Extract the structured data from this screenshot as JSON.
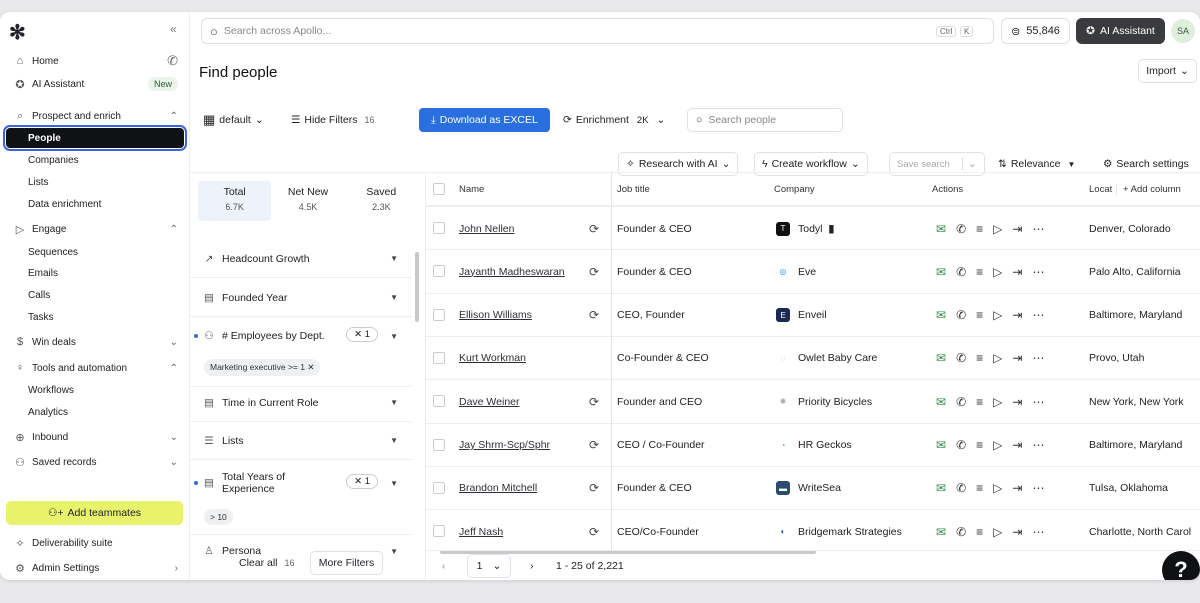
{
  "sidebar": {
    "items": [
      {
        "label": "Home"
      },
      {
        "label": "AI Assistant",
        "badge": "New"
      },
      {
        "label": "Prospect and enrich"
      },
      {
        "label": "People"
      },
      {
        "label": "Companies"
      },
      {
        "label": "Lists"
      },
      {
        "label": "Data enrichment"
      },
      {
        "label": "Engage"
      },
      {
        "label": "Sequences"
      },
      {
        "label": "Emails"
      },
      {
        "label": "Calls"
      },
      {
        "label": "Tasks"
      },
      {
        "label": "Win deals"
      },
      {
        "label": "Tools and automation"
      },
      {
        "label": "Workflows"
      },
      {
        "label": "Analytics"
      },
      {
        "label": "Inbound"
      },
      {
        "label": "Saved records"
      }
    ],
    "add_teammates": "Add teammates",
    "deliverability": "Deliverability suite",
    "admin": "Admin Settings"
  },
  "topbar": {
    "search_placeholder": "Search across Apollo...",
    "kbd_ctrl": "Ctrl",
    "kbd_k": "K",
    "credits": "55,846",
    "ai_button": "AI Assistant",
    "avatar": "SA"
  },
  "page": {
    "title": "Find people",
    "import": "Import"
  },
  "toolbar": {
    "view": "default",
    "hide_filters": "Hide Filters",
    "hide_filters_count": "16",
    "download": "Download as EXCEL",
    "enrichment": "Enrichment",
    "enrichment_count": "2K",
    "search_people": "Search people",
    "research_ai": "Research with AI",
    "create_workflow": "Create workflow",
    "save_search": "Save search",
    "relevance": "Relevance",
    "search_settings": "Search settings"
  },
  "counts": [
    {
      "label": "Total",
      "value": "6.7K"
    },
    {
      "label": "Net New",
      "value": "4.5K"
    },
    {
      "label": "Saved",
      "value": "2.3K"
    }
  ],
  "filters": {
    "headcount": "Headcount Growth",
    "founded": "Founded Year",
    "employees": "# Employees by Dept.",
    "employees_count": "1",
    "employees_chip": "Marketing executive >= 1",
    "time_role": "Time in Current Role",
    "lists": "Lists",
    "total_years": "Total Years of Experience",
    "total_years_count": "1",
    "total_years_chip": "> 10",
    "persona": "Persona",
    "clear_all": "Clear all",
    "clear_count": "16",
    "more_filters": "More Filters"
  },
  "table": {
    "headers": {
      "name": "Name",
      "job": "Job title",
      "company": "Company",
      "actions": "Actions",
      "location": "Locat",
      "add_column": "+ Add column"
    },
    "rows": [
      {
        "name": "John Nellen",
        "job": "Founder & CEO",
        "company": "Todyl",
        "location": "Denver, Colorado"
      },
      {
        "name": "Jayanth Madheswaran",
        "job": "Founder & CEO",
        "company": "Eve",
        "location": "Palo Alto, California"
      },
      {
        "name": "Ellison Williams",
        "job": "CEO, Founder",
        "company": "Enveil",
        "location": "Baltimore, Maryland"
      },
      {
        "name": "Kurt Workman",
        "job": "Co-Founder & CEO",
        "company": "Owlet Baby Care",
        "location": "Provo, Utah"
      },
      {
        "name": "Dave Weiner",
        "job": "Founder and CEO",
        "company": "Priority Bicycles",
        "location": "New York, New York"
      },
      {
        "name": "Jay Shrm-Scp/Sphr",
        "job": "CEO / Co-Founder",
        "company": "HR Geckos",
        "location": "Baltimore, Maryland"
      },
      {
        "name": "Brandon Mitchell",
        "job": "Founder & CEO",
        "company": "WriteSea",
        "location": "Tulsa, Oklahoma"
      },
      {
        "name": "Jeff Nash",
        "job": "CEO/Co-Founder",
        "company": "Bridgemark Strategies",
        "location": "Charlotte, North Carol"
      }
    ]
  },
  "pagination": {
    "page": "1",
    "range": "1 - 25 of 2,221"
  },
  "help": "?",
  "colors": {
    "accent": "#2a6fe0",
    "highlight": "#e8f26a",
    "active_nav": "#0f1115"
  }
}
